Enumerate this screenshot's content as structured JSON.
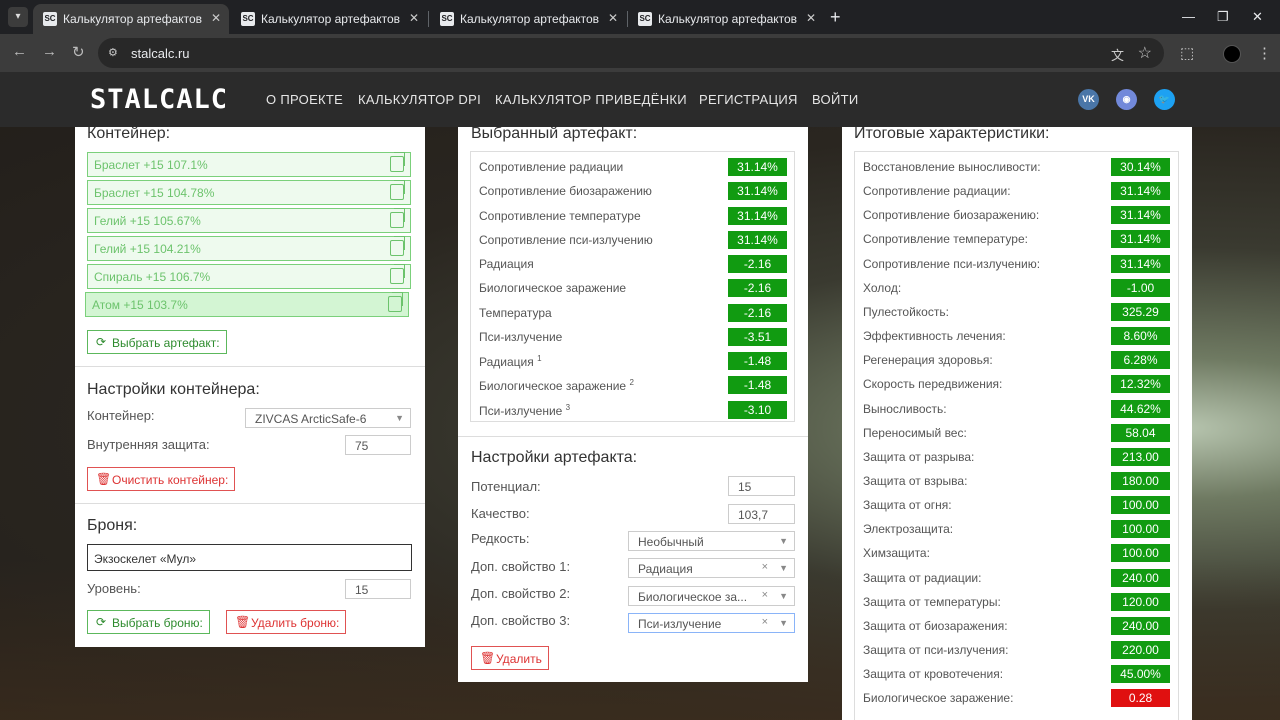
{
  "browser": {
    "tabs": [
      {
        "title": "Калькулятор артефактов STALCALC",
        "favicon": "SC"
      },
      {
        "title": "Калькулятор артефактов STALCALC",
        "favicon": "SC"
      },
      {
        "title": "Калькулятор артефактов STALCALC",
        "favicon": "SC"
      },
      {
        "title": "Калькулятор артефактов STALCALC",
        "favicon": "SC"
      }
    ],
    "url": "stalcalc.ru"
  },
  "header": {
    "logo": "STALCALC",
    "nav": [
      "О ПРОЕКТЕ",
      "КАЛЬКУЛЯТОР DPI",
      "КАЛЬКУЛЯТОР ПРИВЕДЁНКИ",
      "РЕГИСТРАЦИЯ",
      "ВОЙТИ"
    ],
    "social": [
      "vk-icon",
      "discord-icon",
      "twitter-icon"
    ]
  },
  "container_panel": {
    "title": "Контейнер:",
    "artifacts": [
      "Браслет +15 107.1%",
      "Браслет +15 104.78%",
      "Гелий +15 105.67%",
      "Гелий +15 104.21%",
      "Спираль +15 106.7%",
      "Атом +15 103.7%"
    ],
    "choose_artifact": "Выбрать артефакт:",
    "settings_title": "Настройки контейнера:",
    "container_label": "Контейнер:",
    "container_value": "ZIVCAS ArcticSafe-6",
    "inner_protection_label": "Внутренняя защита:",
    "inner_protection_value": "75",
    "clear_container": "Очистить контейнер:",
    "armor_title": "Броня:",
    "armor_value": "Экзоскелет «Мул»",
    "level_label": "Уровень:",
    "level_value": "15",
    "choose_armor": "Выбрать броню:",
    "delete_armor": "Удалить броню:"
  },
  "selected_artifact": {
    "title": "Выбранный артефакт:",
    "stats": [
      {
        "label": "Сопротивление радиации",
        "sup": "",
        "value": "31.14%"
      },
      {
        "label": "Сопротивление биозаражению",
        "sup": "",
        "value": "31.14%"
      },
      {
        "label": "Сопротивление температуре",
        "sup": "",
        "value": "31.14%"
      },
      {
        "label": "Сопротивление пси-излучению",
        "sup": "",
        "value": "31.14%"
      },
      {
        "label": "Радиация",
        "sup": "",
        "value": "-2.16"
      },
      {
        "label": "Биологическое заражение",
        "sup": "",
        "value": "-2.16"
      },
      {
        "label": "Температура",
        "sup": "",
        "value": "-2.16"
      },
      {
        "label": "Пси-излучение",
        "sup": "",
        "value": "-3.51"
      },
      {
        "label": "Радиация",
        "sup": "1",
        "value": "-1.48"
      },
      {
        "label": "Биологическое заражение",
        "sup": "2",
        "value": "-1.48"
      },
      {
        "label": "Пси-излучение",
        "sup": "3",
        "value": "-3.10"
      }
    ],
    "settings_title": "Настройки артефакта:",
    "potential_label": "Потенциал:",
    "potential_value": "15",
    "quality_label": "Качество:",
    "quality_value": "103,7",
    "rarity_label": "Редкость:",
    "rarity_value": "Необычный",
    "extra1_label": "Доп. свойство 1:",
    "extra1_value": "Радиация",
    "extra2_label": "Доп. свойство 2:",
    "extra2_value": "Биологическое за...",
    "extra3_label": "Доп. свойство 3:",
    "extra3_value": "Пси-излучение",
    "clear_symbol": "×",
    "delete": "Удалить"
  },
  "totals": {
    "title": "Итоговые характеристики:",
    "stats": [
      {
        "label": "Восстановление выносливости:",
        "value": "30.14%",
        "status": "positive"
      },
      {
        "label": "Сопротивление радиации:",
        "value": "31.14%",
        "status": "positive"
      },
      {
        "label": "Сопротивление биозаражению:",
        "value": "31.14%",
        "status": "positive"
      },
      {
        "label": "Сопротивление температуре:",
        "value": "31.14%",
        "status": "positive"
      },
      {
        "label": "Сопротивление пси-излучению:",
        "value": "31.14%",
        "status": "positive"
      },
      {
        "label": "Холод:",
        "value": "-1.00",
        "status": "positive"
      },
      {
        "label": "Пулестойкость:",
        "value": "325.29",
        "status": "positive"
      },
      {
        "label": "Эффективность лечения:",
        "value": "8.60%",
        "status": "positive"
      },
      {
        "label": "Регенерация здоровья:",
        "value": "6.28%",
        "status": "positive"
      },
      {
        "label": "Скорость передвижения:",
        "value": "12.32%",
        "status": "positive"
      },
      {
        "label": "Выносливость:",
        "value": "44.62%",
        "status": "positive"
      },
      {
        "label": "Переносимый вес:",
        "value": "58.04",
        "status": "positive"
      },
      {
        "label": "Защита от разрыва:",
        "value": "213.00",
        "status": "positive"
      },
      {
        "label": "Защита от взрыва:",
        "value": "180.00",
        "status": "positive"
      },
      {
        "label": "Защита от огня:",
        "value": "100.00",
        "status": "positive"
      },
      {
        "label": "Электрозащита:",
        "value": "100.00",
        "status": "positive"
      },
      {
        "label": "Химзащита:",
        "value": "100.00",
        "status": "positive"
      },
      {
        "label": "Защита от радиации:",
        "value": "240.00",
        "status": "positive"
      },
      {
        "label": "Защита от температуры:",
        "value": "120.00",
        "status": "positive"
      },
      {
        "label": "Защита от биозаражения:",
        "value": "240.00",
        "status": "positive"
      },
      {
        "label": "Защита от пси-излучения:",
        "value": "220.00",
        "status": "positive"
      },
      {
        "label": "Защита от кровотечения:",
        "value": "45.00%",
        "status": "positive"
      },
      {
        "label": "Биологическое заражение:",
        "value": "0.28",
        "status": "negative"
      }
    ]
  },
  "colors": {
    "positive": "#119b11",
    "negative": "#e01010",
    "accent_green": "#5cb85c",
    "accent_red": "#e05252"
  }
}
